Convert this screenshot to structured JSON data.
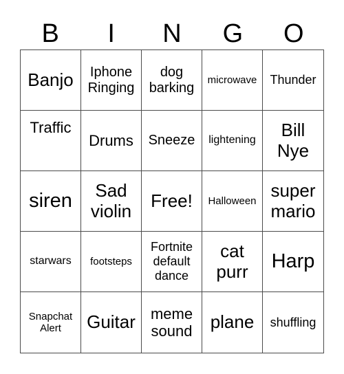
{
  "header": {
    "letters": [
      "B",
      "I",
      "N",
      "G",
      "O"
    ]
  },
  "board": {
    "rows": [
      [
        "Banjo",
        "Iphone Ringing",
        "dog barking",
        "microwave",
        "Thunder"
      ],
      [
        "Traffic",
        "Drums",
        "Sneeze",
        "lightening",
        "Bill Nye"
      ],
      [
        "siren",
        "Sad violin",
        "Free!",
        "Halloween",
        "super mario"
      ],
      [
        "starwars",
        "footsteps",
        "Fortnite default dance",
        "cat purr",
        "Harp"
      ],
      [
        "Snapchat Alert",
        "Guitar",
        "meme sound",
        "plane",
        "shuffling"
      ]
    ]
  }
}
